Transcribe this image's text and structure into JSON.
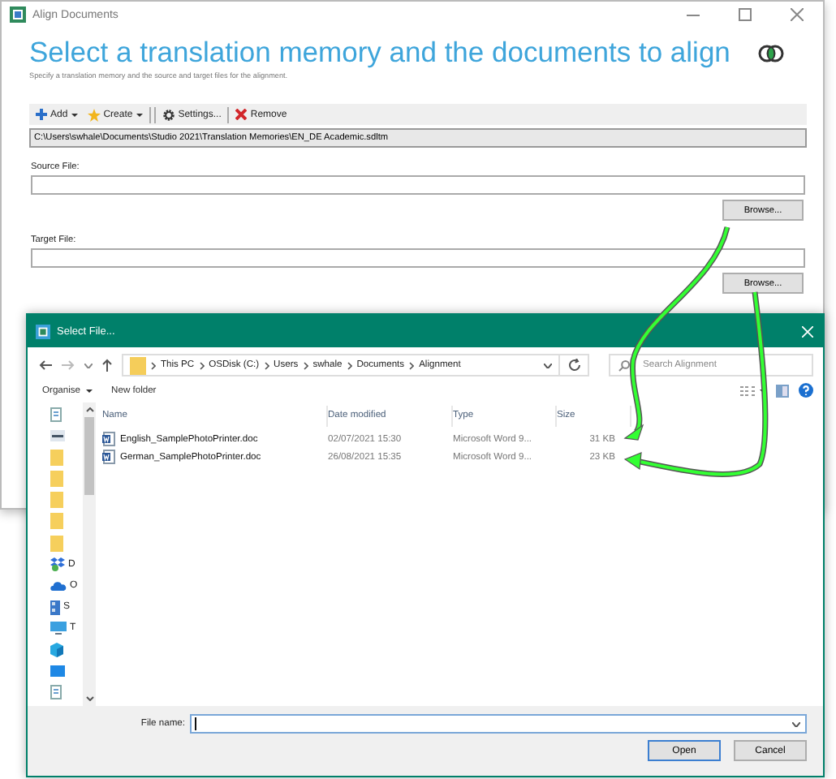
{
  "main_window": {
    "title": "Align Documents",
    "heading": "Select a translation memory and the documents to align",
    "subtitle": "Specify a translation memory and the source and target files for the alignment.",
    "toolbar": [
      {
        "kind": "add",
        "label": "Add",
        "dropdown": true
      },
      {
        "kind": "create",
        "label": "Create",
        "dropdown": true
      },
      {
        "kind": "settings",
        "label": "Settings...",
        "dropdown": false
      },
      {
        "kind": "remove",
        "label": "Remove",
        "dropdown": false
      }
    ],
    "tm_path": "C:\\Users\\swhale\\Documents\\Studio 2021\\Translation Memories\\EN_DE Academic.sdltm",
    "fields": [
      {
        "label": "Source File:",
        "button": "Browse..."
      },
      {
        "label": "Target File:",
        "button": "Browse..."
      }
    ]
  },
  "file_dialog": {
    "title": "Select File...",
    "breadcrumb": [
      "This PC",
      "OSDisk (C:)",
      "Users",
      "swhale",
      "Documents",
      "Alignment"
    ],
    "search_placeholder": "Search Alignment",
    "organise": "Organise",
    "new_folder": "New folder",
    "columns": [
      "Name",
      "Date modified",
      "Type",
      "Size"
    ],
    "files": [
      {
        "name": "English_SamplePhotoPrinter.doc",
        "date": "02/07/2021 15:30",
        "type": "Microsoft Word 9...",
        "size": "31 KB"
      },
      {
        "name": "German_SamplePhotoPrinter.doc",
        "date": "26/08/2021 15:35",
        "type": "Microsoft Word 9...",
        "size": "23 KB"
      }
    ],
    "nav_items": [
      {
        "kind": "doc"
      },
      {
        "kind": "image"
      },
      {
        "kind": "folder"
      },
      {
        "kind": "folder"
      },
      {
        "kind": "folder"
      },
      {
        "kind": "folder"
      },
      {
        "kind": "folder"
      },
      {
        "kind": "dropbox",
        "label": "D"
      },
      {
        "kind": "cloud",
        "label": "O"
      },
      {
        "kind": "drive",
        "label": "S"
      },
      {
        "kind": "pc",
        "label": "T"
      },
      {
        "kind": "cube"
      },
      {
        "kind": "desktop"
      },
      {
        "kind": "doc"
      }
    ],
    "file_name_label": "File name:",
    "buttons": [
      {
        "label": "Open",
        "default": true
      },
      {
        "label": "Cancel",
        "default": false
      }
    ]
  }
}
